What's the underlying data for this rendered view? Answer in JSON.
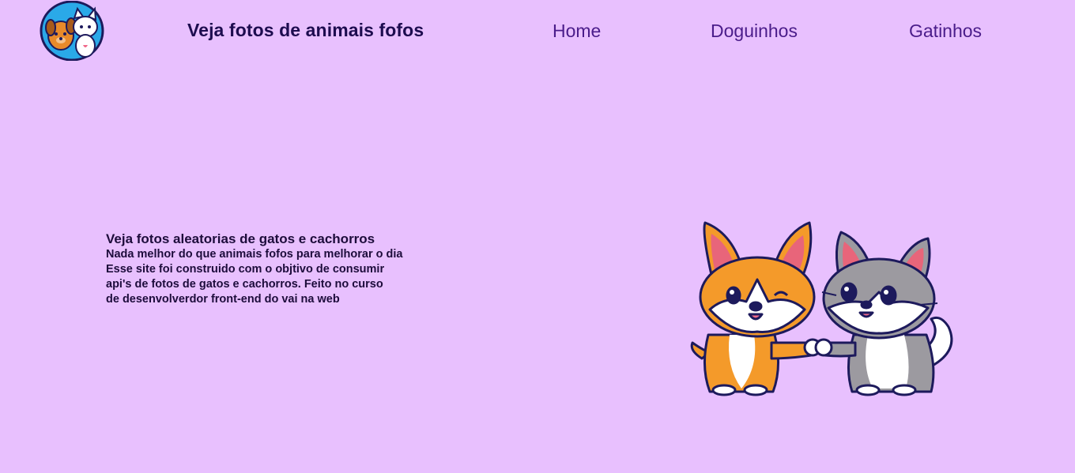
{
  "header": {
    "logo_icon": "dog-and-cat-logo",
    "title": "Veja fotos de animais fofos"
  },
  "nav": {
    "items": [
      {
        "label": "Home"
      },
      {
        "label": "Doguinhos"
      },
      {
        "label": "Gatinhos"
      }
    ]
  },
  "main": {
    "heading": "Veja fotos aleatorias de gatos e cachorros",
    "lines": [
      "Nada melhor do que animais fofos para melhorar o dia",
      "Esse site foi construido com o objtivo de consumir",
      "api's de fotos de gatos e cachorros. Feito no curso",
      "de desenvolverdor front-end do vai na web"
    ],
    "illustration": "dog-and-cat-fist-bump-illustration"
  },
  "colors": {
    "background": "#e8c0fe",
    "title": "#1d0c4f",
    "nav_link": "#4a1c8a"
  }
}
